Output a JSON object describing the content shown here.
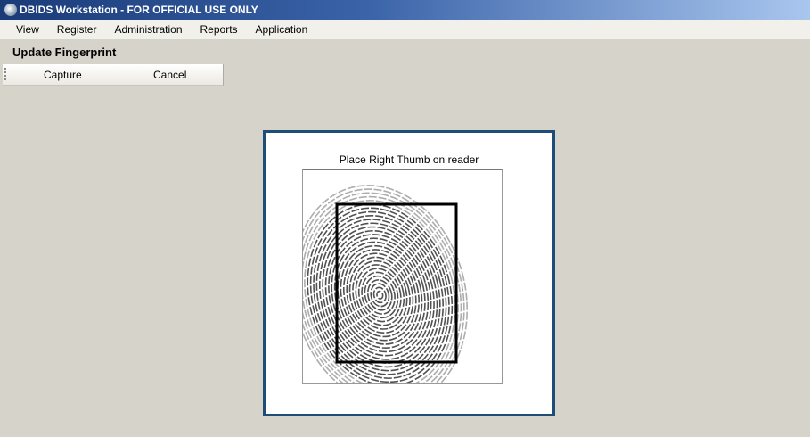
{
  "window": {
    "title": "DBIDS Workstation - FOR OFFICIAL USE ONLY"
  },
  "menu": [
    {
      "label": "View"
    },
    {
      "label": "Register"
    },
    {
      "label": "Administration"
    },
    {
      "label": "Reports"
    },
    {
      "label": "Application"
    }
  ],
  "page": {
    "title": "Update Fingerprint"
  },
  "toolbar": {
    "capture_label": "Capture",
    "cancel_label": "Cancel"
  },
  "scanner": {
    "prompt": "Place Right Thumb on reader"
  },
  "colors": {
    "panel_border": "#1e4d78",
    "background": "#d6d3ca"
  }
}
